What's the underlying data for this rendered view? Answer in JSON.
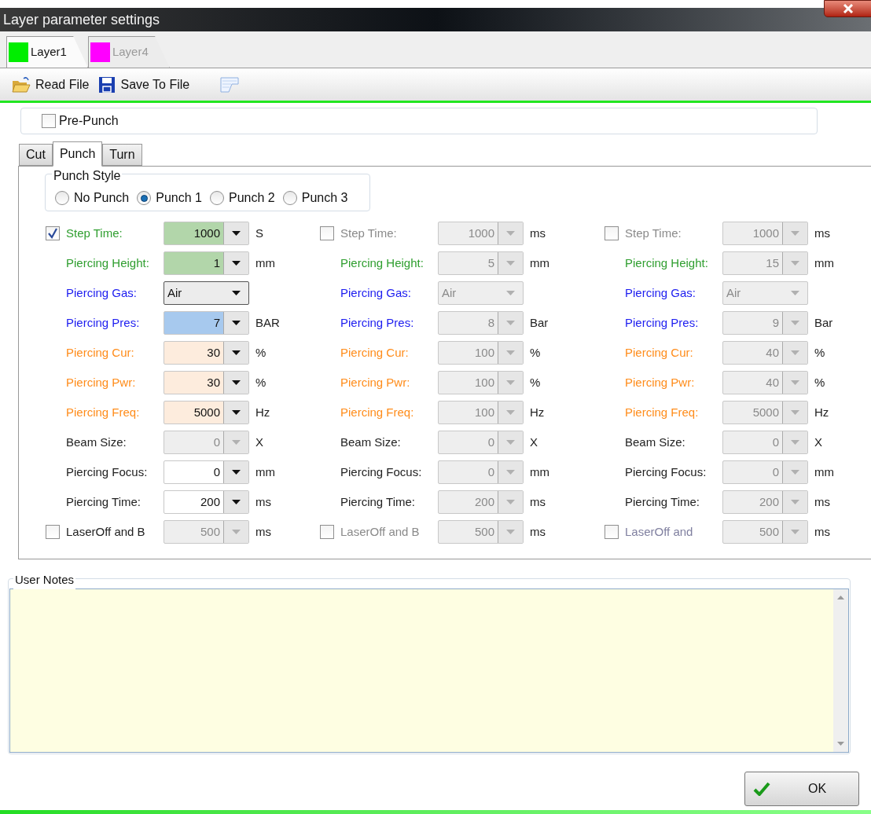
{
  "window": {
    "title": "Layer parameter settings"
  },
  "layer_tabs": [
    {
      "label": "Layer1",
      "color": "#00ee00",
      "selected": true
    },
    {
      "label": "Layer4",
      "color": "#ff00ff",
      "selected": false
    }
  ],
  "toolbar": [
    {
      "label": "Read File",
      "kind": "open"
    },
    {
      "label": "Save To File",
      "kind": "save"
    },
    {
      "kind": "notes"
    }
  ],
  "pre_punch": {
    "label": "Pre-Punch",
    "checked": false
  },
  "tabs": [
    {
      "label": "Cut",
      "selected": false
    },
    {
      "label": "Punch",
      "selected": true
    },
    {
      "label": "Turn",
      "selected": false
    }
  ],
  "punch_style": {
    "title": "Punch Style",
    "options": [
      {
        "label": "No Punch",
        "selected": false
      },
      {
        "label": "Punch 1",
        "selected": true
      },
      {
        "label": "Punch 2",
        "selected": false
      },
      {
        "label": "Punch 3",
        "selected": false
      }
    ]
  },
  "columns": [
    {
      "rows": [
        {
          "kind": "number",
          "checked": true,
          "label": {
            "text": "Step Time:",
            "color": "#2f9e2f"
          },
          "field": {
            "value": "1000",
            "color": "#b2d6aa",
            "disabled": false
          },
          "unit": "S"
        },
        {
          "kind": "number",
          "label": {
            "text": "Piercing Height:",
            "color": "#2f9e2f"
          },
          "field": {
            "value": "1",
            "color": "#b2d6aa",
            "disabled": false
          },
          "unit": "mm"
        },
        {
          "kind": "select",
          "label": {
            "text": "Piercing Gas:",
            "color": "#1c1cf0"
          },
          "field": {
            "value": "Air",
            "color": "#ececec",
            "disabled": false
          }
        },
        {
          "kind": "number",
          "label": {
            "text": "Piercing Pres:",
            "color": "#1c1cf0"
          },
          "field": {
            "value": "7",
            "color": "#a7c9ee",
            "disabled": false
          },
          "unit": "BAR"
        },
        {
          "kind": "number",
          "label": {
            "text": "Piercing Cur:",
            "color": "#ff8c1a"
          },
          "field": {
            "value": "30",
            "color": "#fdecdd",
            "disabled": false
          },
          "unit": "%"
        },
        {
          "kind": "number",
          "label": {
            "text": "Piercing Pwr:",
            "color": "#ff8c1a"
          },
          "field": {
            "value": "30",
            "color": "#fdecdd",
            "disabled": false
          },
          "unit": "%"
        },
        {
          "kind": "number",
          "label": {
            "text": "Piercing Freq:",
            "color": "#ff8c1a"
          },
          "field": {
            "value": "5000",
            "color": "#fdecdd",
            "disabled": false
          },
          "unit": "Hz"
        },
        {
          "kind": "number",
          "label": {
            "text": "Beam Size:",
            "color": "#222222"
          },
          "field": {
            "value": "0",
            "color": "#eeeeee",
            "disabled": true
          },
          "unit": "X"
        },
        {
          "kind": "number",
          "label": {
            "text": "Piercing Focus:",
            "color": "#222222"
          },
          "field": {
            "value": "0",
            "color": "#ffffff",
            "disabled": false
          },
          "unit": "mm"
        },
        {
          "kind": "number",
          "label": {
            "text": "Piercing Time:",
            "color": "#222222"
          },
          "field": {
            "value": "200",
            "color": "#ffffff",
            "disabled": false
          },
          "unit": "ms"
        },
        {
          "kind": "number",
          "checked": false,
          "label": {
            "text": "LaserOff and B",
            "color": "#222222"
          },
          "field": {
            "value": "500",
            "color": "#eeeeee",
            "disabled": true
          },
          "unit": "ms"
        }
      ]
    },
    {
      "rows": [
        {
          "kind": "number",
          "checked": false,
          "label": {
            "text": "Step Time:",
            "color": "#8a8a8a"
          },
          "field": {
            "value": "1000",
            "color": "#eeeeee",
            "disabled": true
          },
          "unit": "ms"
        },
        {
          "kind": "number",
          "label": {
            "text": "Piercing Height:",
            "color": "#2f9e2f"
          },
          "field": {
            "value": "5",
            "color": "#eeeeee",
            "disabled": true
          },
          "unit": "mm"
        },
        {
          "kind": "select",
          "label": {
            "text": "Piercing Gas:",
            "color": "#1c1cf0"
          },
          "field": {
            "value": "Air",
            "color": "#eeeeee",
            "disabled": true
          }
        },
        {
          "kind": "number",
          "label": {
            "text": "Piercing Pres:",
            "color": "#1c1cf0"
          },
          "field": {
            "value": "8",
            "color": "#eeeeee",
            "disabled": true
          },
          "unit": "Bar"
        },
        {
          "kind": "number",
          "label": {
            "text": "Piercing Cur:",
            "color": "#ff8c1a"
          },
          "field": {
            "value": "100",
            "color": "#eeeeee",
            "disabled": true
          },
          "unit": "%"
        },
        {
          "kind": "number",
          "label": {
            "text": "Piercing Pwr:",
            "color": "#ff8c1a"
          },
          "field": {
            "value": "100",
            "color": "#eeeeee",
            "disabled": true
          },
          "unit": "%"
        },
        {
          "kind": "number",
          "label": {
            "text": "Piercing Freq:",
            "color": "#ff8c1a"
          },
          "field": {
            "value": "100",
            "color": "#eeeeee",
            "disabled": true
          },
          "unit": "Hz"
        },
        {
          "kind": "number",
          "label": {
            "text": "Beam Size:",
            "color": "#222222"
          },
          "field": {
            "value": "0",
            "color": "#eeeeee",
            "disabled": true
          },
          "unit": "X"
        },
        {
          "kind": "number",
          "label": {
            "text": "Piercing Focus:",
            "color": "#222222"
          },
          "field": {
            "value": "0",
            "color": "#eeeeee",
            "disabled": true
          },
          "unit": "mm"
        },
        {
          "kind": "number",
          "label": {
            "text": "Piercing Time:",
            "color": "#222222"
          },
          "field": {
            "value": "200",
            "color": "#eeeeee",
            "disabled": true
          },
          "unit": "ms"
        },
        {
          "kind": "number",
          "checked": false,
          "label": {
            "text": "LaserOff and B",
            "color": "#8a8a8a"
          },
          "field": {
            "value": "500",
            "color": "#eeeeee",
            "disabled": true
          },
          "unit": "ms"
        }
      ]
    },
    {
      "rows": [
        {
          "kind": "number",
          "checked": false,
          "label": {
            "text": "Step Time:",
            "color": "#8a8a8a"
          },
          "field": {
            "value": "1000",
            "color": "#eeeeee",
            "disabled": true
          },
          "unit": "ms"
        },
        {
          "kind": "number",
          "label": {
            "text": "Piercing Height:",
            "color": "#2f9e2f"
          },
          "field": {
            "value": "15",
            "color": "#eeeeee",
            "disabled": true
          },
          "unit": "mm"
        },
        {
          "kind": "select",
          "label": {
            "text": "Piercing Gas:",
            "color": "#1c1cf0"
          },
          "field": {
            "value": "Air",
            "color": "#eeeeee",
            "disabled": true
          }
        },
        {
          "kind": "number",
          "label": {
            "text": "Piercing Pres:",
            "color": "#1c1cf0"
          },
          "field": {
            "value": "9",
            "color": "#eeeeee",
            "disabled": true
          },
          "unit": "Bar"
        },
        {
          "kind": "number",
          "label": {
            "text": "Piercing Cur:",
            "color": "#ff8c1a"
          },
          "field": {
            "value": "40",
            "color": "#eeeeee",
            "disabled": true
          },
          "unit": "%"
        },
        {
          "kind": "number",
          "label": {
            "text": "Piercing Pwr:",
            "color": "#ff8c1a"
          },
          "field": {
            "value": "40",
            "color": "#eeeeee",
            "disabled": true
          },
          "unit": "%"
        },
        {
          "kind": "number",
          "label": {
            "text": "Piercing Freq:",
            "color": "#ff8c1a"
          },
          "field": {
            "value": "5000",
            "color": "#eeeeee",
            "disabled": true
          },
          "unit": "Hz"
        },
        {
          "kind": "number",
          "label": {
            "text": "Beam Size:",
            "color": "#222222"
          },
          "field": {
            "value": "0",
            "color": "#eeeeee",
            "disabled": true
          },
          "unit": "X"
        },
        {
          "kind": "number",
          "label": {
            "text": "Piercing Focus:",
            "color": "#222222"
          },
          "field": {
            "value": "0",
            "color": "#eeeeee",
            "disabled": true
          },
          "unit": "mm"
        },
        {
          "kind": "number",
          "label": {
            "text": "Piercing Time:",
            "color": "#222222"
          },
          "field": {
            "value": "200",
            "color": "#eeeeee",
            "disabled": true
          },
          "unit": "ms"
        },
        {
          "kind": "number",
          "checked": false,
          "label": {
            "text": "LaserOff and",
            "color": "#8080a0"
          },
          "field": {
            "value": "500",
            "color": "#eeeeee",
            "disabled": true
          },
          "unit": "ms"
        }
      ]
    }
  ],
  "user_notes": {
    "title": "User Notes"
  },
  "ok_button": {
    "label": "OK"
  }
}
